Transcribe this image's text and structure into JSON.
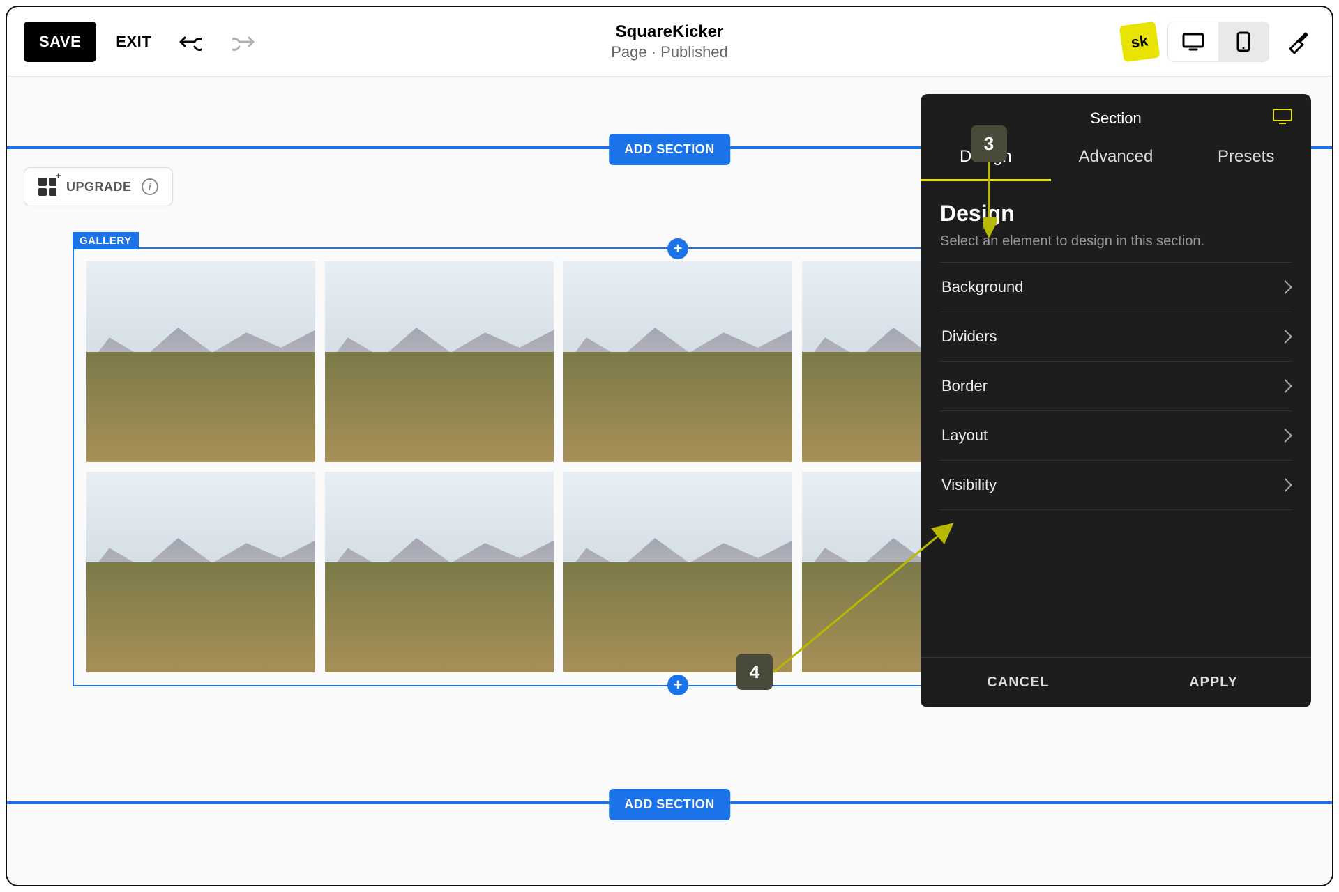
{
  "topbar": {
    "save": "SAVE",
    "exit": "EXIT",
    "title": "SquareKicker",
    "status": "Page · Published",
    "sk_badge": "sk"
  },
  "upgrade": {
    "label": "UPGRADE"
  },
  "add_section_label": "ADD SECTION",
  "gallery": {
    "tag": "GALLERY"
  },
  "panel": {
    "heading": "Section",
    "tabs": {
      "design": "Design",
      "advanced": "Advanced",
      "presets": "Presets"
    },
    "title": "Design",
    "subtitle": "Select an element to design in this section.",
    "items": {
      "background": "Background",
      "dividers": "Dividers",
      "border": "Border",
      "layout": "Layout",
      "visibility": "Visibility"
    },
    "footer": {
      "cancel": "CANCEL",
      "apply": "APPLY"
    }
  },
  "callouts": {
    "c3": "3",
    "c4": "4"
  }
}
